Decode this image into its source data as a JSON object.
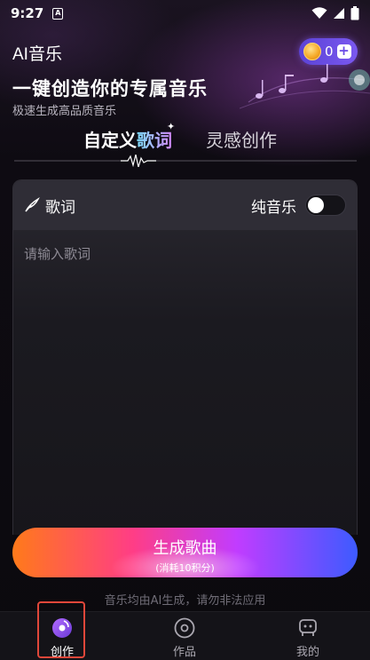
{
  "status_bar": {
    "time": "9:27",
    "notification_icon": "A"
  },
  "header": {
    "app_title": "AI音乐",
    "coin_count": "0",
    "coin_plus": "+"
  },
  "hero": {
    "title": "一键创造你的专属音乐",
    "subtitle": "极速生成高品质音乐"
  },
  "tabs": [
    {
      "label_part1": "自定义",
      "label_part2": "歌词",
      "active": true
    },
    {
      "label": "灵感创作",
      "active": false
    }
  ],
  "editor": {
    "lyric_label": "歌词",
    "pure_music_label": "纯音乐",
    "pure_music_on": false,
    "lyric_placeholder": "请输入歌词",
    "lyric_value": ""
  },
  "generate": {
    "label": "生成歌曲",
    "cost": "(消耗10积分)"
  },
  "disclaimer": "音乐均由AI生成，请勿非法应用",
  "bottom_nav": [
    {
      "label": "创作",
      "icon": "music-disc-icon",
      "active": true
    },
    {
      "label": "作品",
      "icon": "vinyl-icon",
      "active": false
    },
    {
      "label": "我的",
      "icon": "robot-face-icon",
      "active": false
    }
  ],
  "colors": {
    "accent_purple": "#6a4be6",
    "gradient_start": "#ff7a1a",
    "gradient_mid": "#c13cff",
    "gradient_end": "#3d5bff",
    "highlight_box": "#e0473a"
  }
}
